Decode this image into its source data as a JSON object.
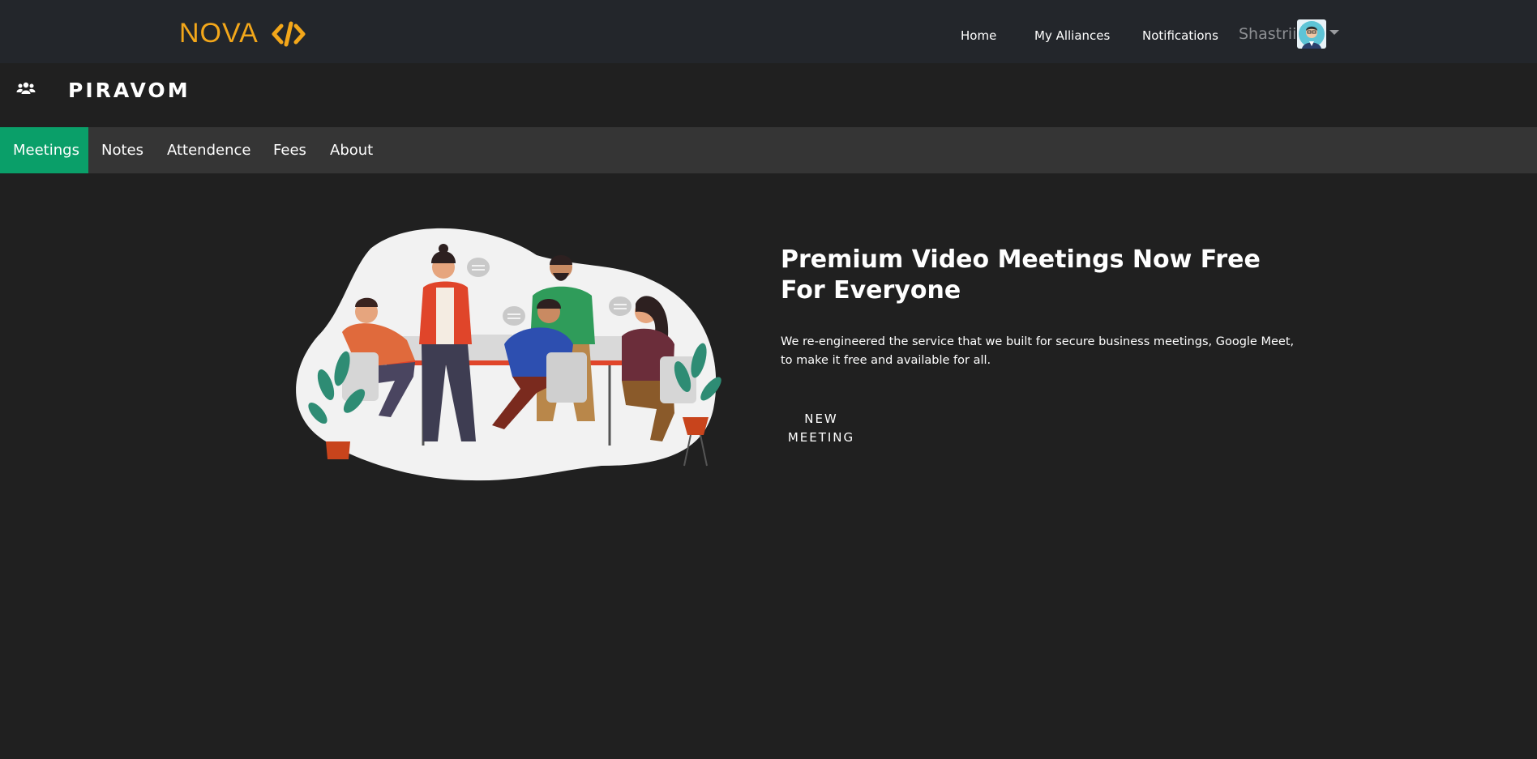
{
  "brand": {
    "name": "NOVA",
    "icon": "code-brackets-icon",
    "color": "#f3a71a"
  },
  "nav": {
    "home": "Home",
    "alliances": "My Alliances",
    "notifications": "Notifications",
    "user_name": "Shastriii"
  },
  "group": {
    "icon": "users-icon",
    "title": "PIRAVOM"
  },
  "tabs": {
    "meetings": "Meetings",
    "notes": "Notes",
    "attendence": "Attendence",
    "fees": "Fees",
    "about": "About",
    "active_color": "#0a9f69"
  },
  "hero": {
    "title": "Premium Video Meetings Now Free For Everyone",
    "description": "We re-engineered the service that we built for secure business meetings, Google Meet, to make it free and available for all.",
    "button": "NEW MEETING",
    "illustration": "team-meeting-illustration"
  }
}
